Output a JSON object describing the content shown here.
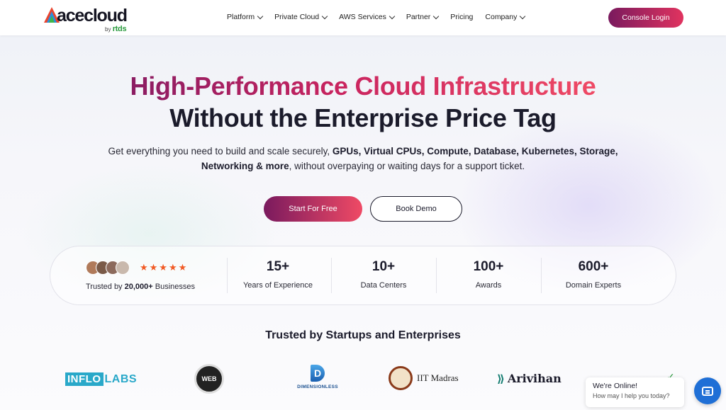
{
  "nav": {
    "logo_word": "acecloud",
    "logo_by": "by",
    "logo_brand": "rtds",
    "menu": [
      {
        "label": "Platform",
        "dropdown": true
      },
      {
        "label": "Private Cloud",
        "dropdown": true
      },
      {
        "label": "AWS Services",
        "dropdown": true
      },
      {
        "label": "Partner",
        "dropdown": true
      },
      {
        "label": "Pricing",
        "dropdown": false
      },
      {
        "label": "Company",
        "dropdown": true
      }
    ],
    "console_login": "Console Login"
  },
  "hero": {
    "headline_1": "High-Performance Cloud Infrastructure",
    "headline_2": "Without the Enterprise Price Tag",
    "sub_1": "Get everything you need to build and scale securely, ",
    "sub_bold_1": "GPUs, Virtual CPUs, Compute, Database, Kubernetes, Storage, Networking & more",
    "sub_2": ", without overpaying or waiting days for a support ticket.",
    "cta_primary": "Start For Free",
    "cta_secondary": "Book Demo"
  },
  "stats": {
    "rating_stars": "★★★★★",
    "trusted_prefix": "Trusted by ",
    "trusted_count": "20,000+",
    "trusted_suffix": " Businesses",
    "items": [
      {
        "value": "15+",
        "label": "Years of Experience"
      },
      {
        "value": "10+",
        "label": "Data Centers"
      },
      {
        "value": "100+",
        "label": "Awards"
      },
      {
        "value": "600+",
        "label": "Domain Experts"
      }
    ]
  },
  "trusted": {
    "title": "Trusted by Startups and Enterprises",
    "logos": {
      "inflo_box": "INFLO",
      "inflo_txt": "LABS",
      "web": "WEB",
      "dim_mark": "D",
      "dim_txt": "DIMENSIONLESS",
      "iit": "IIT Madras",
      "arivihan": "Arivihan"
    }
  },
  "chat": {
    "status": "We're Online!",
    "prompt": "How may I help you today?"
  },
  "colors": {
    "brand_gradient_start": "#7a1a5e",
    "brand_gradient_end": "#ef4a65",
    "star": "#f15a24",
    "chat": "#1f6fd6"
  }
}
